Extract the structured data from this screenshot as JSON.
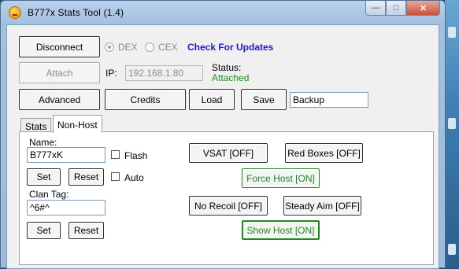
{
  "window": {
    "title": "B777x Stats Tool (1.4)",
    "minimize_glyph": "—",
    "maximize_glyph": "□",
    "close_glyph": "✕"
  },
  "toolbar": {
    "disconnect_label": "Disconnect",
    "platform_options": [
      {
        "label": "DEX",
        "selected": true
      },
      {
        "label": "CEX",
        "selected": false
      }
    ],
    "check_updates_label": "Check For Updates",
    "attach_label": "Attach",
    "ip_label": "IP:",
    "ip_value": "192.168.1.80",
    "status_label": "Status:",
    "status_value": "Attached",
    "advanced_label": "Advanced",
    "credits_label": "Credits",
    "load_label": "Load",
    "save_label": "Save",
    "backup_value": "Backup"
  },
  "tabs": [
    {
      "label": "Stats",
      "active": false
    },
    {
      "label": "Non-Host",
      "active": true
    }
  ],
  "nonhost": {
    "name_label": "Name:",
    "name_value": "B777xK",
    "flash_label": "Flash",
    "set_label": "Set",
    "reset_label": "Reset",
    "auto_label": "Auto",
    "clan_tag_label": "Clan Tag:",
    "clan_tag_value": "^6#^",
    "clan_set_label": "Set",
    "clan_reset_label": "Reset",
    "vsat_label": "VSAT [OFF]",
    "red_boxes_label": "Red Boxes [OFF]",
    "force_host_label": "Force Host [ON]",
    "no_recoil_label": "No Recoil [OFF]",
    "steady_aim_label": "Steady Aim [OFF]",
    "show_host_label": "Show Host [ON]"
  },
  "colors": {
    "link": "#1b1bd6",
    "on_state": "#1e8a1e",
    "window_frame": "#a3c0e0"
  }
}
